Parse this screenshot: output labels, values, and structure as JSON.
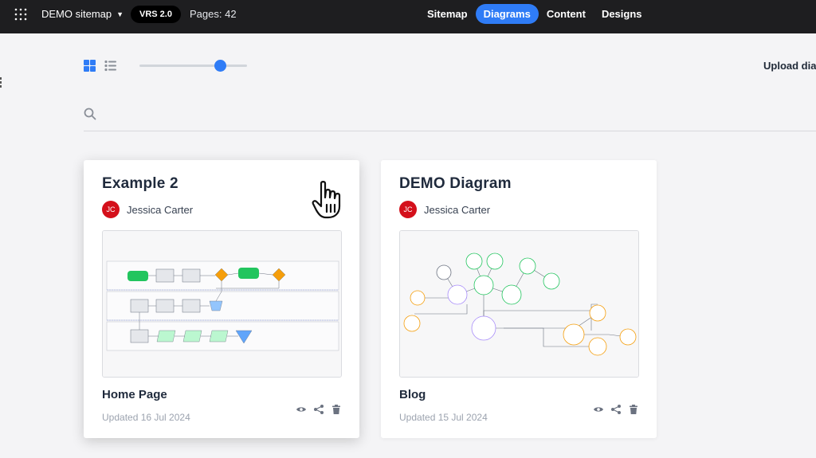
{
  "topbar": {
    "project_name": "DEMO sitemap",
    "version_badge": "VRS 2.0",
    "pages_count": "Pages: 42",
    "nav": [
      {
        "label": "Sitemap",
        "active": false
      },
      {
        "label": "Diagrams",
        "active": true
      },
      {
        "label": "Content",
        "active": false
      },
      {
        "label": "Designs",
        "active": false
      }
    ],
    "accent_color": "#2f7cf6"
  },
  "toolbar": {
    "view_grid_icon": "grid-view-icon",
    "view_list_icon": "list-view-icon",
    "upload_label": "Upload diag"
  },
  "search": {
    "icon": "search-icon",
    "placeholder": ""
  },
  "cards": [
    {
      "title": "Example 2",
      "author_initials": "JC",
      "author_name": "Jessica Carter",
      "page_name": "Home Page",
      "updated": "Updated 16 Jul 2024",
      "thumbnail_kind": "flowchart"
    },
    {
      "title": "DEMO Diagram",
      "author_initials": "JC",
      "author_name": "Jessica Carter",
      "page_name": "Blog",
      "updated": "Updated 15 Jul 2024",
      "thumbnail_kind": "mindmap"
    }
  ],
  "card_actions": [
    "eye-icon",
    "share-icon",
    "trash-icon"
  ],
  "avatar_color": "#d4101b"
}
